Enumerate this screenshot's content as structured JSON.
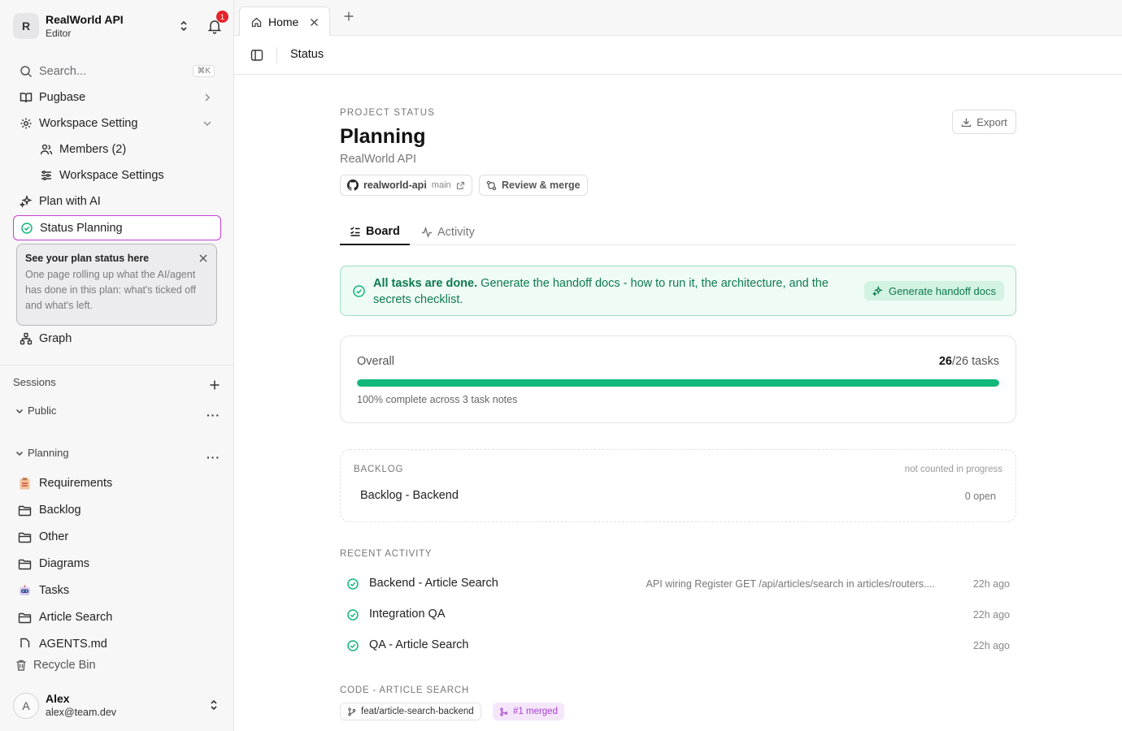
{
  "workspace": {
    "avatar_letter": "R",
    "name": "RealWorld API",
    "role": "Editor",
    "notifications": "1"
  },
  "search": {
    "placeholder": "Search...",
    "shortcut": "⌘K"
  },
  "nav": {
    "pugbase": "Pugbase",
    "workspace_setting": "Workspace Setting",
    "members": "Members (2)",
    "workspace_settings": "Workspace Settings",
    "plan_with_ai": "Plan with AI",
    "status_planning": "Status Planning",
    "graph": "Graph"
  },
  "tooltip": {
    "title": "See your plan status here",
    "body": "One page rolling up what the AI/agent has done in this plan: what's ticked off and what's left."
  },
  "sessions": {
    "title": "Sessions",
    "groups": [
      "Public",
      "Planning"
    ],
    "items": [
      {
        "label": "Requirements",
        "icon": "clipboard-icon"
      },
      {
        "label": "Backlog",
        "icon": "folder-icon"
      },
      {
        "label": "Other",
        "icon": "folder-icon"
      },
      {
        "label": "Diagrams",
        "icon": "folder-icon"
      },
      {
        "label": "Tasks",
        "icon": "robot-icon"
      },
      {
        "label": "Article Search",
        "icon": "folder-icon"
      },
      {
        "label": "AGENTS.md",
        "icon": "file-icon"
      }
    ],
    "recycle_bin": "Recycle Bin"
  },
  "user": {
    "avatar_letter": "A",
    "name": "Alex",
    "email": "alex@team.dev"
  },
  "tabs": [
    {
      "label": "Home",
      "icon": "home-icon"
    }
  ],
  "breadcrumb": "Status",
  "header": {
    "eyebrow": "PROJECT STATUS",
    "title": "Planning",
    "subtitle": "RealWorld API",
    "export_label": "Export",
    "repo": "realworld-api",
    "branch": "main",
    "review": "Review & merge"
  },
  "view_tabs": [
    {
      "label": "Board",
      "active": true
    },
    {
      "label": "Activity",
      "active": false
    }
  ],
  "banner": {
    "strong": "All tasks are done.",
    "text": " Generate the handoff docs - how to run it, the architecture, and the secrets checklist.",
    "button": "Generate handoff docs"
  },
  "overall": {
    "label": "Overall",
    "done": "26",
    "total": "/26 tasks",
    "progress": 1.0,
    "note": "100% complete across 3 task notes"
  },
  "backlog": {
    "title": "BACKLOG",
    "note": "not counted in progress",
    "item": "Backlog - Backend",
    "count": "0 open"
  },
  "recent": {
    "title": "RECENT ACTIVITY",
    "rows": [
      {
        "label": "Backend - Article Search",
        "desc": "API wiring Register GET /api/articles/search in articles/routers....",
        "time": "22h ago"
      },
      {
        "label": "Integration QA",
        "desc": "",
        "time": "22h ago"
      },
      {
        "label": "QA - Article Search",
        "desc": "",
        "time": "22h ago"
      }
    ]
  },
  "code": {
    "title": "CODE - ARTICLE SEARCH",
    "branch": "feat/article-search-backend",
    "pr": "#1 merged"
  },
  "colors": {
    "accent": "#12b77a",
    "active_border": "#c63ed6",
    "merged": "#a43fcf",
    "badge": "#e5252a"
  }
}
